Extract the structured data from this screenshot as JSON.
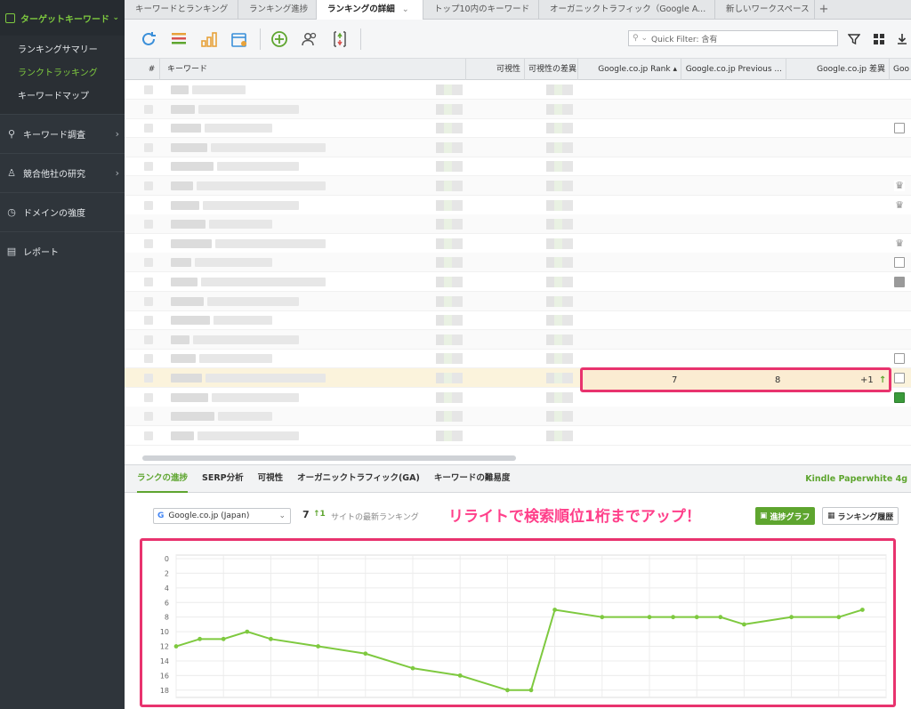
{
  "sidebar": {
    "header": "ターゲットキーワード",
    "items": [
      "ランキングサマリー",
      "ランクトラッキング",
      "キーワードマップ"
    ],
    "sections": [
      "キーワード調査",
      "競合他社の研究",
      "ドメインの強度",
      "レポート"
    ]
  },
  "tabs": [
    "キーワードとランキング",
    "ランキング進捗",
    "ランキングの詳細",
    "トップ10内のキーワード",
    "オーガニックトラフィック（Google A...",
    "新しいワークスペース"
  ],
  "quick_filter": "Quick Filter: 含有",
  "table": {
    "headers": {
      "num": "#",
      "keyword": "キーワード",
      "visibility": "可視性",
      "visibility_diff": "可視性の差異",
      "rank": "Google.co.jp Rank",
      "previous": "Google.co.jp Previous ...",
      "diff": "Google.co.jp 差異",
      "next": "Goo"
    },
    "highlight": {
      "rank": "7",
      "previous": "8",
      "diff": "+1"
    }
  },
  "bottom_tabs": [
    "ランクの進捗",
    "SERP分析",
    "可視性",
    "オーガニックトラフィック(GA)",
    "キーワードの難易度"
  ],
  "bottom_right_label": "Kindle Paperwhite 4g",
  "engine_select": "Google.co.jp (Japan)",
  "latest_rank": "7",
  "rank_change": "1",
  "latest_rank_note": "サイトの最新ランキング",
  "annotation": "リライトで検索順位1桁までアップ！",
  "buttons": {
    "progress_graph": "進捗グラフ",
    "ranking_history": "ランキング履歴"
  },
  "colors": {
    "accent": "#5ea52f",
    "highlight_border": "#e8336e",
    "annotation": "#ff3f8a"
  },
  "chart_data": {
    "type": "line",
    "title": "",
    "xlabel": "",
    "ylabel": "",
    "ylim": [
      0,
      19
    ],
    "y_inverted": true,
    "yticks": [
      0,
      2,
      4,
      6,
      8,
      10,
      12,
      14,
      16,
      18
    ],
    "grid": true,
    "series": [
      {
        "values": [
          12,
          11,
          11,
          10,
          11,
          12,
          13,
          15,
          16,
          18,
          18,
          7,
          8,
          8,
          8,
          8,
          8,
          9,
          8,
          8,
          7
        ]
      }
    ],
    "x": [
      0,
      1,
      2,
      3,
      4,
      6,
      8,
      10,
      12,
      14,
      15,
      16,
      18,
      20,
      21,
      22,
      23,
      24,
      26,
      28,
      29
    ],
    "x_range": [
      0,
      30
    ]
  }
}
